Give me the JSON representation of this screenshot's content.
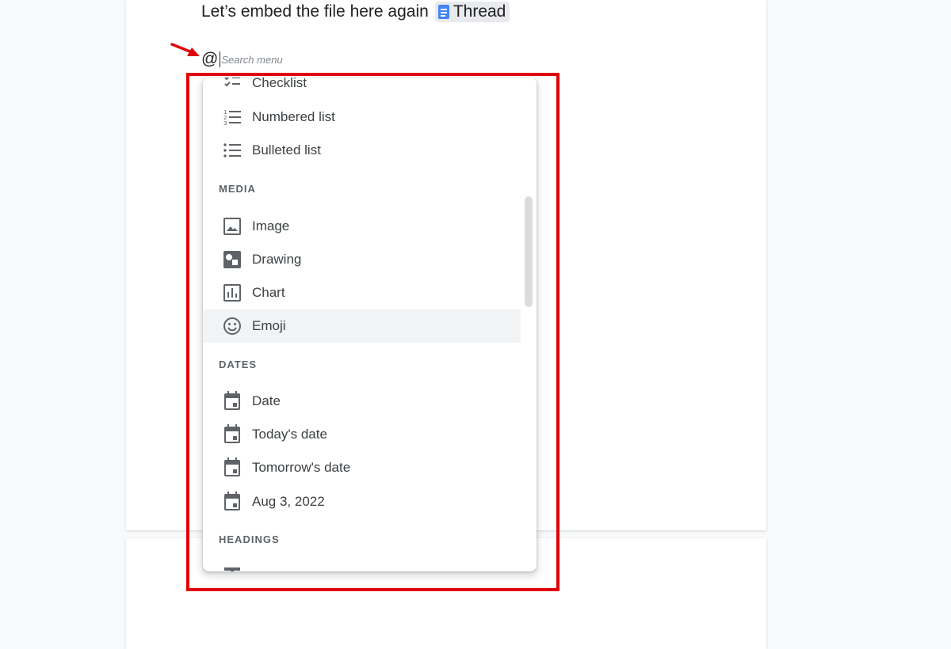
{
  "document": {
    "embed_text": "Let’s embed the file here again",
    "chip_label": "Thread",
    "chip_icon": "google-docs-icon"
  },
  "search": {
    "trigger": "@",
    "placeholder": "Search menu"
  },
  "menu": {
    "list_items": [
      {
        "label": "Checklist",
        "icon": "checklist-icon"
      },
      {
        "label": "Numbered list",
        "icon": "numbered-list-icon"
      },
      {
        "label": "Bulleted list",
        "icon": "bulleted-list-icon"
      }
    ],
    "media": {
      "heading": "MEDIA",
      "items": [
        {
          "label": "Image",
          "icon": "image-icon"
        },
        {
          "label": "Drawing",
          "icon": "drawing-icon"
        },
        {
          "label": "Chart",
          "icon": "chart-icon"
        },
        {
          "label": "Emoji",
          "icon": "emoji-icon",
          "highlighted": true
        }
      ]
    },
    "dates": {
      "heading": "DATES",
      "items": [
        {
          "label": "Date",
          "icon": "calendar-icon"
        },
        {
          "label": "Today's date",
          "icon": "calendar-icon"
        },
        {
          "label": "Tomorrow's date",
          "icon": "calendar-icon"
        },
        {
          "label": "Aug 3, 2022",
          "icon": "calendar-icon"
        }
      ]
    },
    "headings": {
      "heading": "HEADINGS"
    }
  },
  "colors": {
    "annotation_red": "#e0000a",
    "chip_blue": "#4285f4",
    "highlight_row": "#f1f3f4"
  }
}
